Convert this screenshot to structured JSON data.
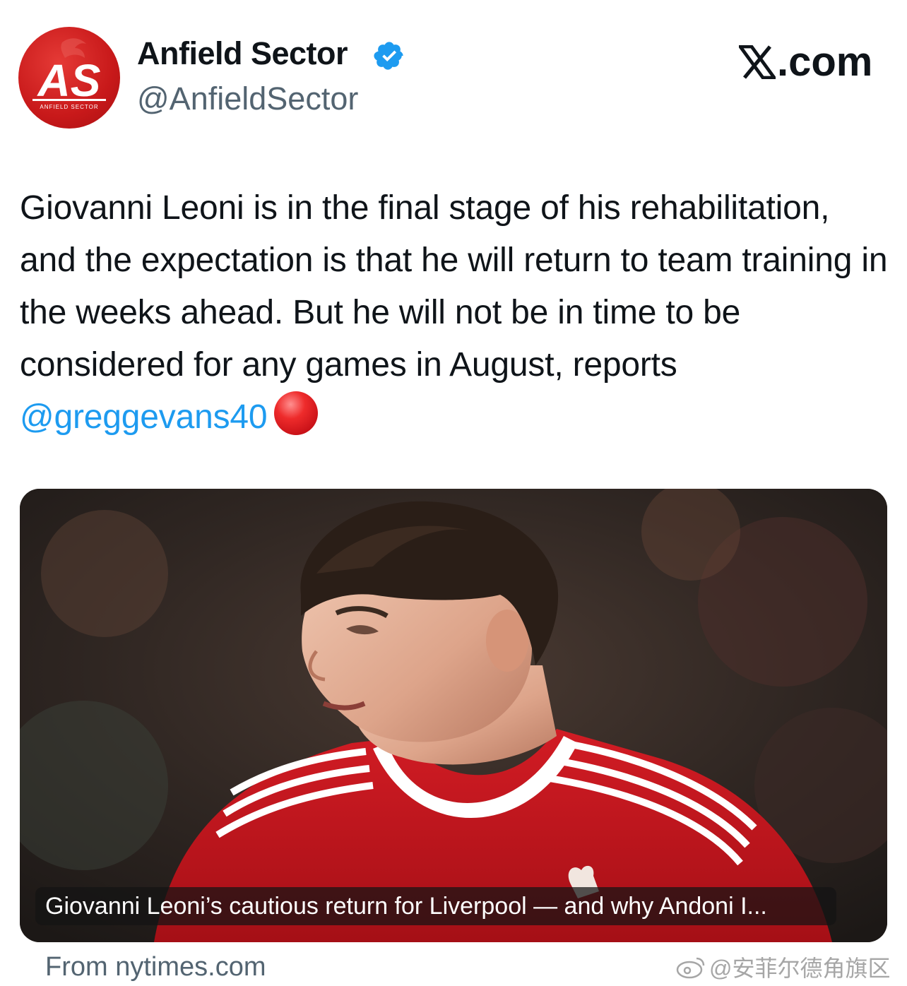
{
  "author": {
    "name": "Anfield Sector",
    "handle": "@AnfieldSector",
    "avatar_text": "AS",
    "avatar_subtext": "ANFIELD SECTOR",
    "verified": true
  },
  "brand": {
    "label": ".com"
  },
  "tweet": {
    "text": "Giovanni Leoni is in the final stage of his rehabilitation, and the expectation is that he will return to team training in the weeks ahead. But he will not be in time to be considered for any games in August, reports",
    "mention": "@greggevans40",
    "emoji": "red-circle"
  },
  "card": {
    "caption": "Giovanni Leoni’s cautious return for Liverpool — and why Andoni I...",
    "source": "From nytimes.com"
  },
  "watermark": {
    "text": "@安菲尔德角旗区"
  },
  "colors": {
    "mention": "#1d9bf0",
    "verified": "#1d9bf0",
    "secondary_text": "#536471",
    "avatar_red": "#c8191a",
    "shirt_red": "#c8141c"
  }
}
